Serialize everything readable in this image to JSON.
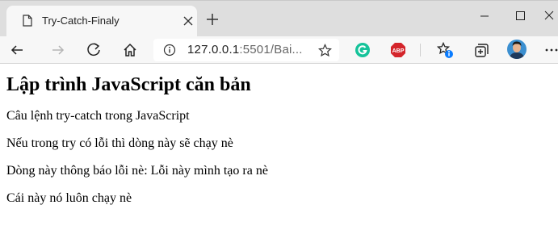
{
  "browser": {
    "tab": {
      "title": "Try-Catch-Finaly"
    },
    "address_bar": {
      "host": "127.0.0.1",
      "rest": ":5501/Bai..."
    },
    "colors": {
      "accent": "#0a7cff",
      "grammarly": "#15c39a",
      "adblock": "#d4252b"
    },
    "icons": [
      "back-icon",
      "forward-icon",
      "refresh-icon",
      "home-icon",
      "info-icon",
      "star-icon",
      "grammarly-icon",
      "adblock-icon",
      "favorites-icon",
      "collections-icon",
      "profile-avatar",
      "more-icon"
    ],
    "adblock_label": "ABP"
  },
  "page": {
    "heading": "Lập trình JavaScript căn bản",
    "lines": [
      "Câu lệnh try-catch trong JavaScript",
      "Nếu trong try có lỗi thì dòng này sẽ chạy nè",
      "Dòng này thông báo lỗi nè: Lỗi này mình tạo ra nè",
      "Cái này nó luôn chạy nè"
    ]
  }
}
